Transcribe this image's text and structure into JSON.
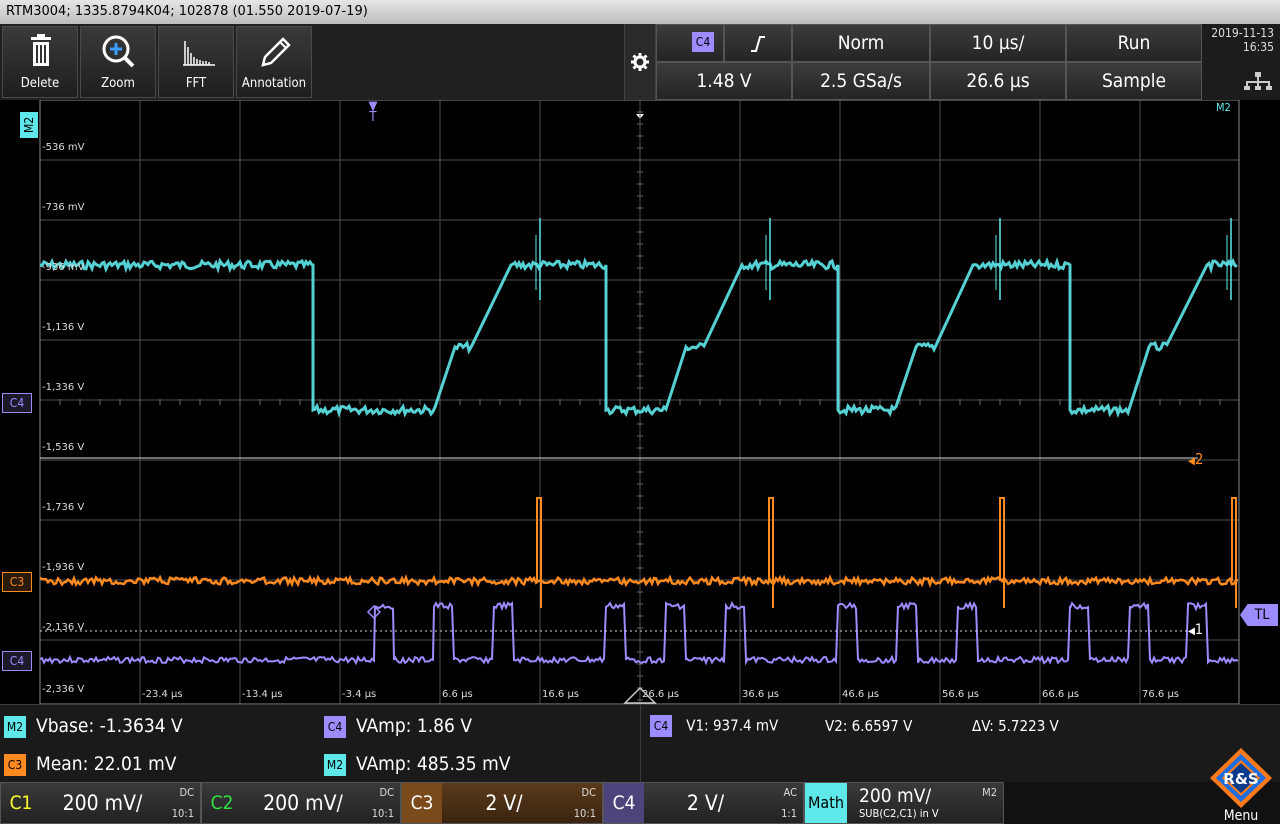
{
  "titlebar": {
    "text": "RTM3004; 1335.8794K04; 102878 (01.550 2019-07-19)"
  },
  "toolbar": {
    "tools": [
      {
        "label": "Delete",
        "icon": "trash-icon"
      },
      {
        "label": "Zoom",
        "icon": "zoom-icon"
      },
      {
        "label": "FFT",
        "icon": "fft-icon"
      },
      {
        "label": "Annotation",
        "icon": "pen-icon"
      }
    ]
  },
  "trigger": {
    "source": "C4",
    "slope_icon": "rising-edge-icon",
    "mode": "Norm",
    "timebase": "10 µs/",
    "state": "Run",
    "level": "1.48 V",
    "sample_rate": "2.5 GSa/s",
    "position": "26.6 µs",
    "acq_mode": "Sample"
  },
  "datetime": {
    "date": "2019-11-13",
    "time": "16:35"
  },
  "screen": {
    "ylabels": [
      "-536 mV",
      "-736 mV",
      "-936 mV",
      "-1,136 V",
      "-1,336 V",
      "-1,536 V",
      "-1,736 V",
      "-1,936 V",
      "-2,136 V",
      "-2,336 V"
    ],
    "xlabels": [
      "-23.4 µs",
      "-13.4 µs",
      "-3.4 µs",
      "6.6 µs",
      "16.6 µs",
      "26.6 µs",
      "36.6 µs",
      "46.6 µs",
      "56.6 µs",
      "66.6 µs",
      "76.6 µs"
    ],
    "m2_tag": "M2",
    "m2_corner": "M2",
    "trig_marker": "T",
    "c2c4_marker": "C4",
    "c3_marker": "C3",
    "c4_marker": "C4",
    "cursor2": "2",
    "cursor1": "1",
    "tl": "TL"
  },
  "colors": {
    "m2": "#5ee8ea",
    "c3": "#ff8a1f",
    "c4": "#9b8cff",
    "c1": "#ffff30",
    "c2": "#30e040",
    "grid": "#555555"
  },
  "measurements": {
    "m1": {
      "src": "M2",
      "label": "Vbase: -1.3634 V"
    },
    "m2": {
      "src": "C4",
      "label": "VAmp: 1.86 V"
    },
    "m3": {
      "src": "C3",
      "label": "Mean: 22.01 mV"
    },
    "m4": {
      "src": "M2",
      "label": "VAmp: 485.35 mV"
    },
    "cursor": {
      "src": "C4",
      "v1": "V1: 937.4 mV",
      "v2": "V2: 6.6597 V",
      "dv": "ΔV: 5.7223 V"
    }
  },
  "channels": [
    {
      "tag": "C1",
      "val": "200 mV/",
      "coupling": "DC",
      "probe": "10:1"
    },
    {
      "tag": "C2",
      "val": "200 mV/",
      "coupling": "DC",
      "probe": "10:1"
    },
    {
      "tag": "C3",
      "val": "2 V/",
      "coupling": "DC",
      "probe": "10:1"
    },
    {
      "tag": "C4",
      "val": "2 V/",
      "coupling": "AC",
      "probe": "1:1"
    }
  ],
  "math": {
    "tag": "Math",
    "val": "200 mV/",
    "formula": "SUB(C2,C1) in V",
    "corner": "M2"
  },
  "menu": {
    "label": "Menu",
    "logo": "rohde-schwarz-logo"
  }
}
